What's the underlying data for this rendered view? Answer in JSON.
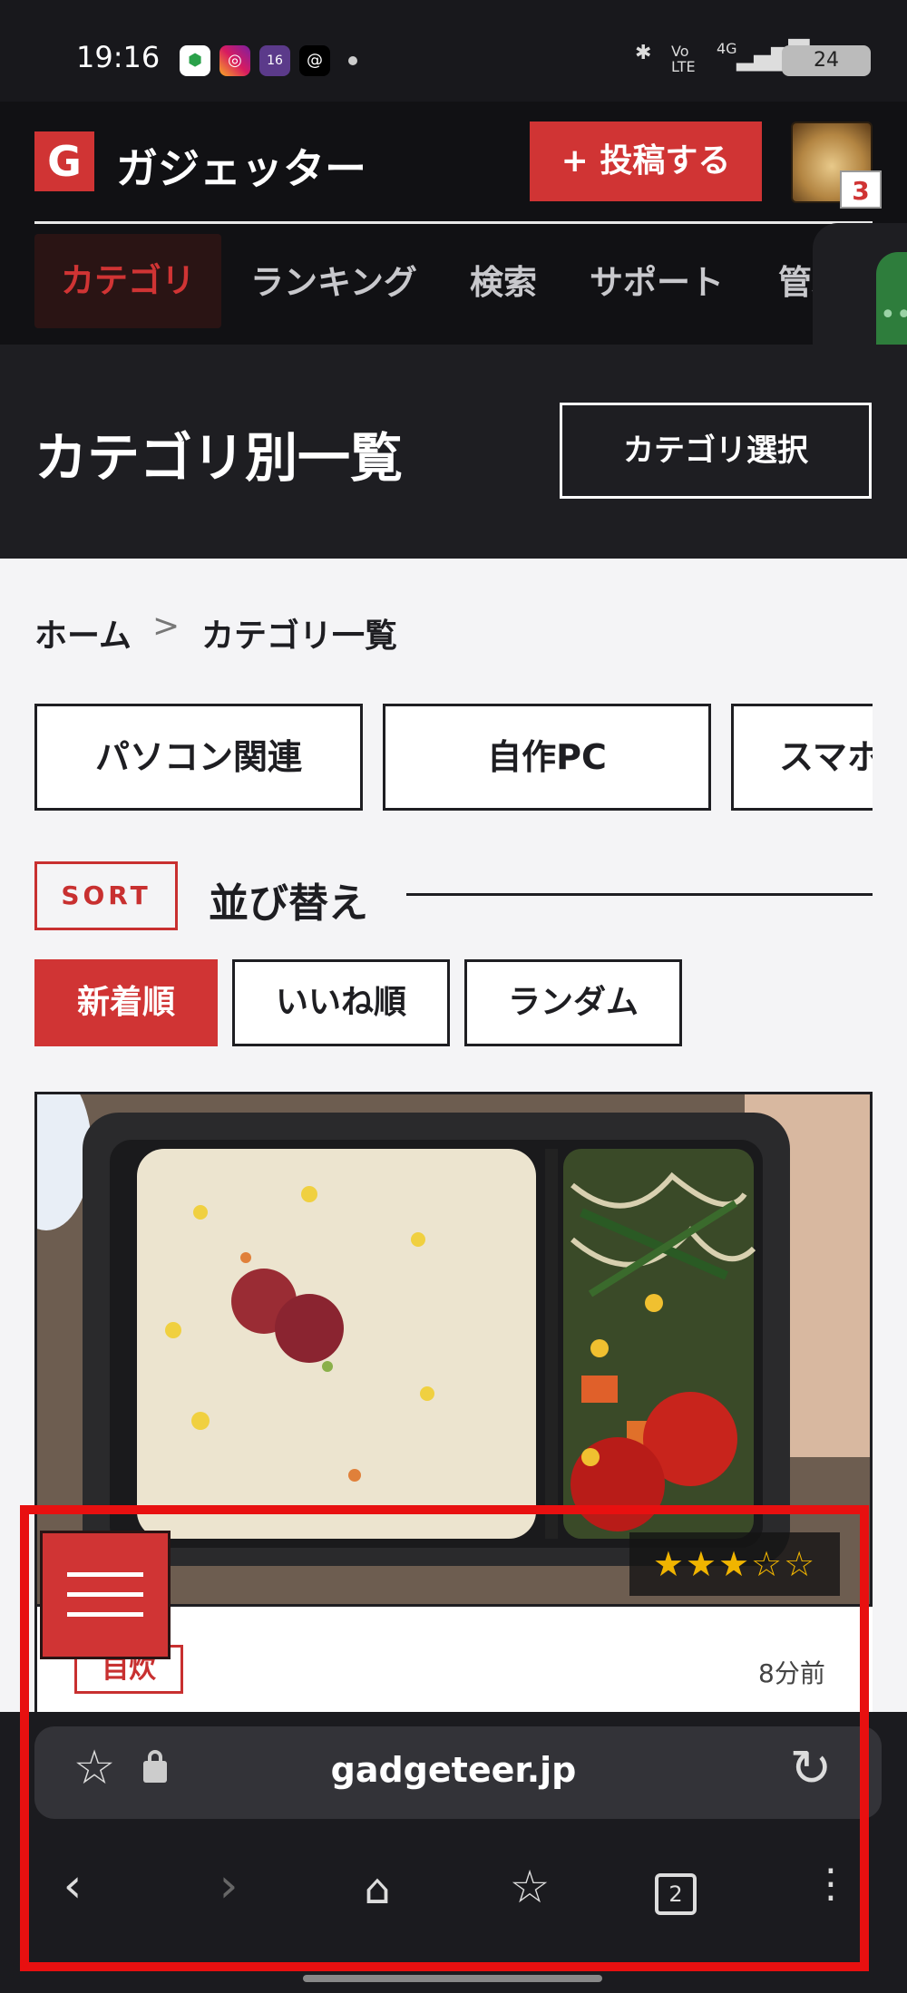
{
  "status_bar": {
    "time": "19:16",
    "apps": [
      "shield-app",
      "instagram-app",
      "calendar-app",
      "threads-app"
    ],
    "calendar_badge": "16",
    "network": "4G",
    "volte": "Vo LTE",
    "battery": "24"
  },
  "header": {
    "logo_letter": "G",
    "site_name": "ガジェッター",
    "post_button": "+ 投稿する",
    "notification_count": "3",
    "nav": [
      "カテゴリ",
      "ランキング",
      "検索",
      "サポート",
      "管理"
    ]
  },
  "title_band": {
    "title": "カテゴリ別一覧",
    "select_button": "カテゴリ選択"
  },
  "breadcrumb": {
    "home": "ホーム",
    "separator": ">",
    "current": "カテゴリ一覧"
  },
  "categories": [
    "パソコン関連",
    "自作PC",
    "スマホ"
  ],
  "sort": {
    "tag": "SORT",
    "label": "並び替え",
    "options": [
      "新着順",
      "いいね順",
      "ランダム"
    ],
    "active": "新着順"
  },
  "card": {
    "rating": "★★★☆☆",
    "rating_value": 3,
    "rating_max": 5,
    "category_tag": "自炊",
    "time_ago": "8分前"
  },
  "browser": {
    "url": "gadgeteer.jp",
    "tab_count": "2"
  },
  "colors": {
    "brand_red": "#d03434",
    "dark": "#111114",
    "highlight": "#e81010"
  }
}
